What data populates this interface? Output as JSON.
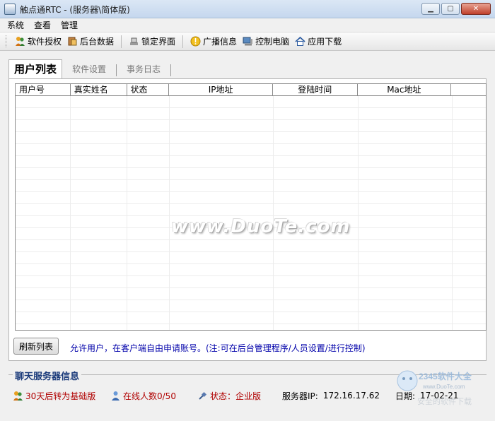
{
  "window": {
    "title": "触点通RTC - (服务器\\简体版)"
  },
  "menu": [
    "系统",
    "查看",
    "管理"
  ],
  "toolbar": [
    {
      "label": "软件授权",
      "icon": "people-icon"
    },
    {
      "label": "后台数据",
      "icon": "database-icon"
    },
    {
      "label": "锁定界面",
      "icon": "lock-icon"
    },
    {
      "label": "广播信息",
      "icon": "info-icon"
    },
    {
      "label": "控制电脑",
      "icon": "computer-icon"
    },
    {
      "label": "应用下载",
      "icon": "home-icon"
    }
  ],
  "tabs": {
    "active": "用户列表",
    "others": [
      "软件设置",
      "事务日志"
    ]
  },
  "table": {
    "columns": [
      "用户号",
      "真实姓名",
      "状态",
      "IP地址",
      "登陆时间",
      "Mac地址"
    ],
    "rows": []
  },
  "watermark": "www.DuoTe.com",
  "refresh_label": "刷新列表",
  "hint": "允许用户，在客户端自由申请账号。(注:可在后台管理程序/人员设置/进行控制)",
  "server_info": {
    "title": "聊天服务器信息",
    "trial": "30天后转为基础版",
    "online": "在线人数0/50",
    "status": "状态：企业版",
    "ip_label": "服务器IP:",
    "ip": "172.16.17.62",
    "date_label": "日期:",
    "date": "17-02-21"
  },
  "corner_logo": {
    "brand": "2345软件大全",
    "url": "www.DuoTe.com",
    "tagline": "安全的软件下载"
  },
  "colors": {
    "accent_blue": "#0000aa",
    "title_blue": "#1a3a7a",
    "status_red": "#b00000"
  }
}
